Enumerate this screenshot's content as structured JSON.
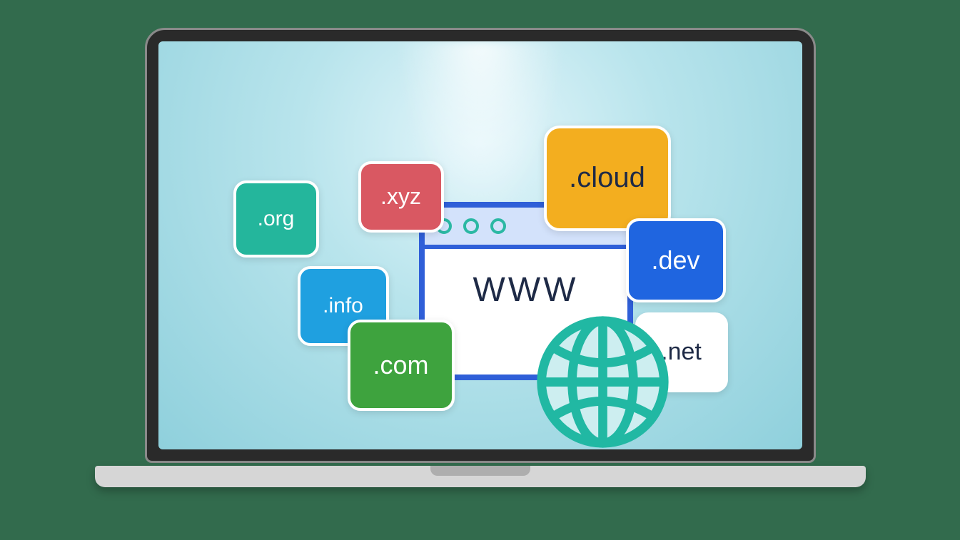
{
  "tlds": {
    "org": ".org",
    "xyz": ".xyz",
    "cloud": ".cloud",
    "dev": ".dev",
    "info": ".info",
    "com": ".com",
    "net": ".net"
  },
  "browser": {
    "title": "WWW"
  }
}
